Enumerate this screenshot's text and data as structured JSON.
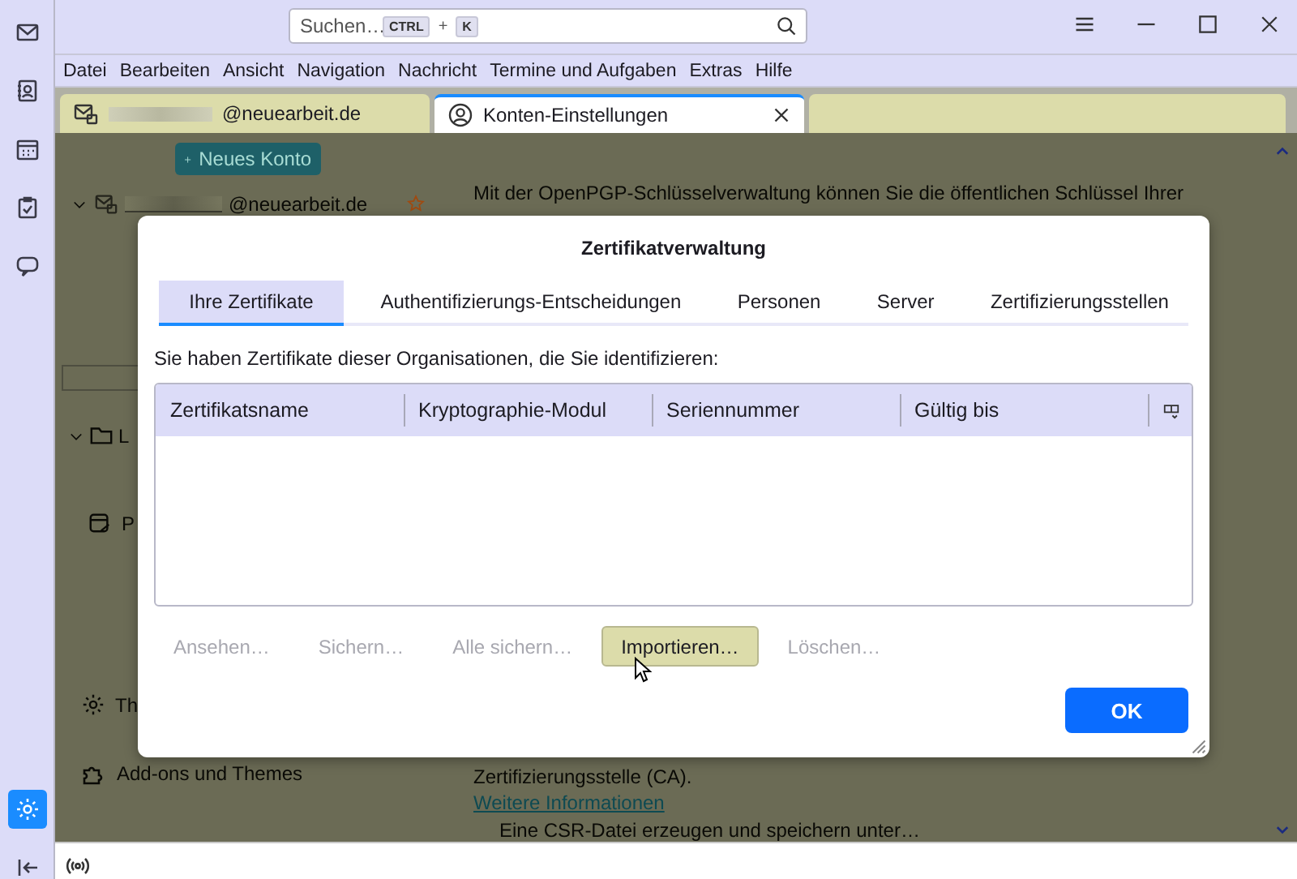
{
  "rail": [
    {
      "kind": "mail",
      "selected": false
    },
    {
      "kind": "contacts",
      "selected": false
    },
    {
      "kind": "calendar",
      "selected": false
    },
    {
      "kind": "tasks",
      "selected": false
    },
    {
      "kind": "chat",
      "selected": false
    },
    {
      "kind": "settings",
      "selected": true
    },
    {
      "kind": "collapse",
      "selected": false
    }
  ],
  "search": {
    "placeholder": "Suchen…",
    "keys": [
      "CTRL",
      "+",
      "K"
    ]
  },
  "menu": [
    "Datei",
    "Bearbeiten",
    "Ansicht",
    "Navigation",
    "Nachricht",
    "Termine und Aufgaben",
    "Extras",
    "Hilfe"
  ],
  "tabs": [
    {
      "label": "@neuearbeit.de",
      "kind": "mail",
      "selected": false
    },
    {
      "label": "Konten-Einstellungen",
      "kind": "settings",
      "selected": true
    }
  ],
  "sidebar": {
    "new_account": "Neues Konto",
    "account": "@neuearbeit.de",
    "items": [
      {
        "kind": "folder",
        "label": "L"
      },
      {
        "kind": "page",
        "label": "P"
      },
      {
        "kind": "gear",
        "label": "Th"
      },
      {
        "kind": "puzzle",
        "label": "Add-ons und Themes"
      }
    ]
  },
  "main": {
    "intro": "Mit der OpenPGP-Schlüsselverwaltung können Sie die öffentlichen Schlüssel Ihrer",
    "ca_text": "Zertifizierungsstelle (CA).",
    "link": "Weitere Informationen",
    "csr": "Eine CSR-Datei erzeugen und speichern unter…"
  },
  "dialog": {
    "title": "Zertifikatverwaltung",
    "tabs": [
      {
        "label": "Ihre Zertifikate",
        "selected": true
      },
      {
        "label": "Authentifizierungs-Entscheidungen",
        "selected": false
      },
      {
        "label": "Personen",
        "selected": false
      },
      {
        "label": "Server",
        "selected": false
      },
      {
        "label": "Zertifizierungsstellen",
        "selected": false
      }
    ],
    "description": "Sie haben Zertifikate dieser Organisationen, die Sie identifizieren:",
    "columns": [
      "Zertifikatsname",
      "Kryptographie-Modul",
      "Seriennummer",
      "Gültig bis"
    ],
    "buttons": [
      {
        "label": "Ansehen…",
        "disabled": true
      },
      {
        "label": "Sichern…",
        "disabled": true
      },
      {
        "label": "Alle sichern…",
        "disabled": true
      },
      {
        "label": "Importieren…",
        "disabled": false
      },
      {
        "label": "Löschen…",
        "disabled": true
      }
    ],
    "ok": "OK"
  }
}
